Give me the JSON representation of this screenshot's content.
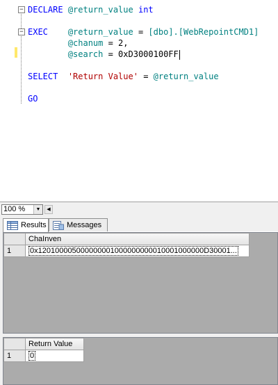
{
  "editor": {
    "lines": {
      "l1": {
        "kw": "DECLARE",
        "var": "@return_value",
        "type": "int"
      },
      "l2": {
        "kw": "EXEC",
        "var": "@return_value",
        "eq": " = ",
        "proc": "[dbo].[WebRepointCMD1]"
      },
      "l3": {
        "var": "@chanum",
        "rest": " = 2,"
      },
      "l4": {
        "var": "@search",
        "rest": " = 0xD3000100FF"
      },
      "l5": {
        "kw": "SELECT",
        "str": "'Return Value'",
        "eq": " = ",
        "var": "@return_value"
      },
      "l6": {
        "kw": "GO"
      }
    }
  },
  "zoom": {
    "value": "100 %"
  },
  "tabs": [
    {
      "label": "Results",
      "icon": "grid-icon"
    },
    {
      "label": "Messages",
      "icon": "messages-icon"
    }
  ],
  "results1": {
    "columns": [
      "ChaInven"
    ],
    "rows": [
      {
        "num": "1",
        "values": [
          "0x120100005000000001000000000010001000000D30001..."
        ]
      }
    ]
  },
  "results2": {
    "columns": [
      "Return Value"
    ],
    "rows": [
      {
        "num": "1",
        "values": [
          "0"
        ]
      }
    ]
  },
  "colors": {
    "keyword": "#0000ff",
    "variable": "#008080",
    "string": "#b00000",
    "change_bar": "#ffe86b"
  }
}
